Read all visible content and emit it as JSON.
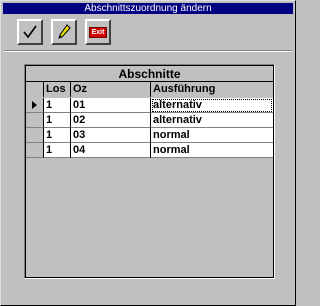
{
  "window": {
    "title": "Abschnittszuordnung ändern"
  },
  "toolbar": {
    "ok_icon": "checkmark-icon",
    "edit_icon": "pencil-icon",
    "exit_label": "Exit"
  },
  "grid": {
    "caption": "Abschnitte",
    "columns": [
      "Los",
      "Oz",
      "Ausführung"
    ],
    "rows": [
      {
        "los": "1",
        "oz": "01",
        "ausfuehrung": "alternativ"
      },
      {
        "los": "1",
        "oz": "02",
        "ausfuehrung": "alternativ"
      },
      {
        "los": "1",
        "oz": "03",
        "ausfuehrung": "normal"
      },
      {
        "los": "1",
        "oz": "04",
        "ausfuehrung": "normal"
      }
    ],
    "selected_row": 0
  }
}
